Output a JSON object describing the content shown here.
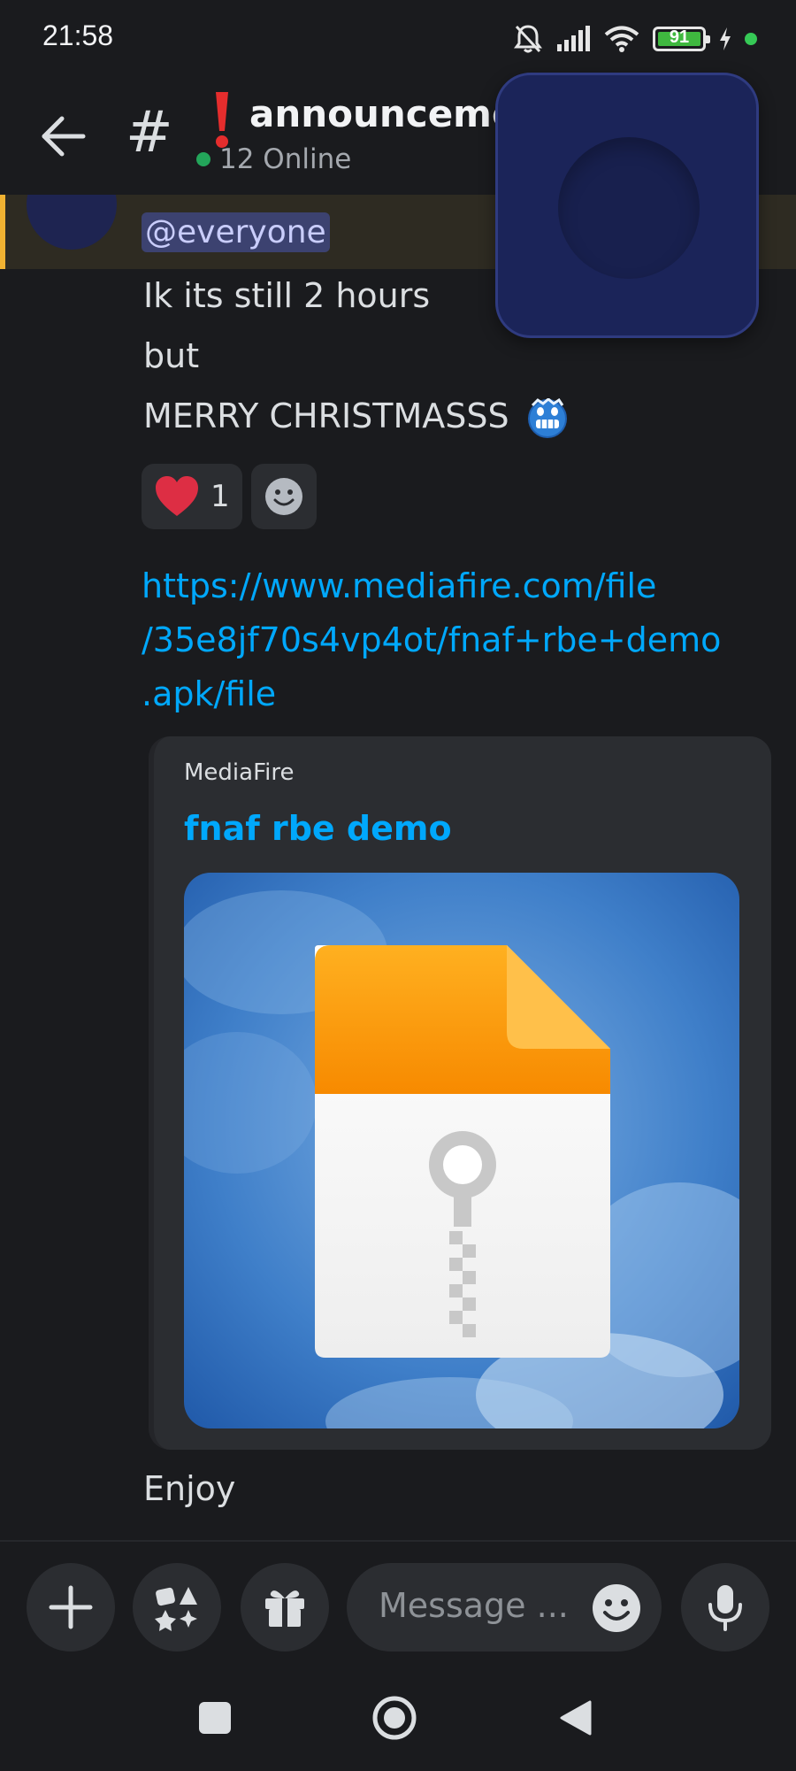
{
  "status_bar": {
    "time": "21:58",
    "battery_level": "91",
    "icons": [
      "mute-bell-icon",
      "signal-icon",
      "wifi-icon",
      "battery-icon",
      "charging-icon"
    ]
  },
  "header": {
    "channel_prefix": "#",
    "channel_emoji": "❗",
    "channel_name": "announceme",
    "online_count": "12 Online"
  },
  "message": {
    "mention": "@everyone",
    "lines": [
      "Ik its still 2 hours",
      "but",
      "MERRY CHRISTMASSS"
    ],
    "reactions": [
      {
        "emoji": "heart-icon",
        "count": "1"
      }
    ],
    "link": "https://www.mediafire.com/file/35e8jf70s4vp4ot/fnaf+rbe+demo.apk/file",
    "link_lines": [
      "https://www.mediafire.com/file",
      "/35e8jf70s4vp4ot/fnaf+rbe+demo",
      ".apk/file"
    ],
    "embed": {
      "provider": "MediaFire",
      "title": "fnaf rbe demo"
    },
    "followup": "Enjoy"
  },
  "composer": {
    "placeholder": "Message ..."
  },
  "colors": {
    "background": "#1a1b1e",
    "link": "#00a8fc",
    "mention_bg": "#3c4270",
    "highlight_bar": "#f0b232",
    "online": "#23a55a"
  }
}
